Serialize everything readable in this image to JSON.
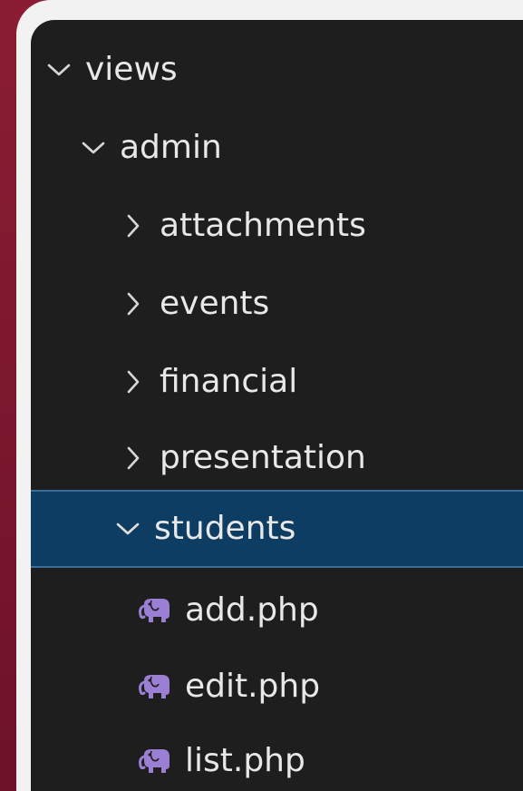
{
  "explorer": {
    "tree": [
      {
        "label": "views",
        "icon": "chevron-down-icon",
        "indent": 0,
        "expanded": true
      },
      {
        "label": "admin",
        "icon": "chevron-down-icon",
        "indent": 1,
        "expanded": true
      },
      {
        "label": "attachments",
        "icon": "chevron-right-icon",
        "indent": 2,
        "expanded": false
      },
      {
        "label": "events",
        "icon": "chevron-right-icon",
        "indent": 2,
        "expanded": false
      },
      {
        "label": "financial",
        "icon": "chevron-right-icon",
        "indent": 2,
        "expanded": false
      },
      {
        "label": "presentation",
        "icon": "chevron-right-icon",
        "indent": 2,
        "expanded": false
      },
      {
        "label": "students",
        "icon": "chevron-down-icon",
        "indent": 2,
        "expanded": true,
        "selected": true
      },
      {
        "label": "add.php",
        "icon": "php-elephant-icon",
        "indent": 3
      },
      {
        "label": "edit.php",
        "icon": "php-elephant-icon",
        "indent": 3
      },
      {
        "label": "list.php",
        "icon": "php-elephant-icon",
        "indent": 3
      }
    ]
  },
  "colors": {
    "panel_background": "#1e1e1e",
    "selection_background": "#0d3d63",
    "text": "#e8e8e8",
    "php_icon": "#9b7fd4",
    "frame": "#7b1830"
  }
}
